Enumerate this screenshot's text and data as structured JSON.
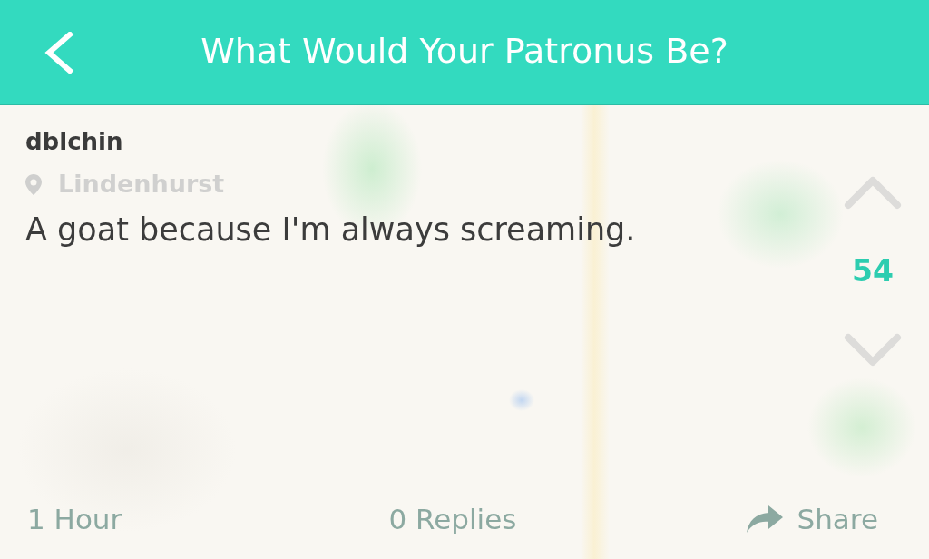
{
  "header": {
    "title": "What Would Your Patronus Be?"
  },
  "post": {
    "author": "dblchin",
    "location": "Lindenhurst",
    "text": "A goat because I'm always screaming.",
    "votes": "54"
  },
  "footer": {
    "time": "1 Hour",
    "replies": "0 Replies",
    "share": "Share"
  }
}
